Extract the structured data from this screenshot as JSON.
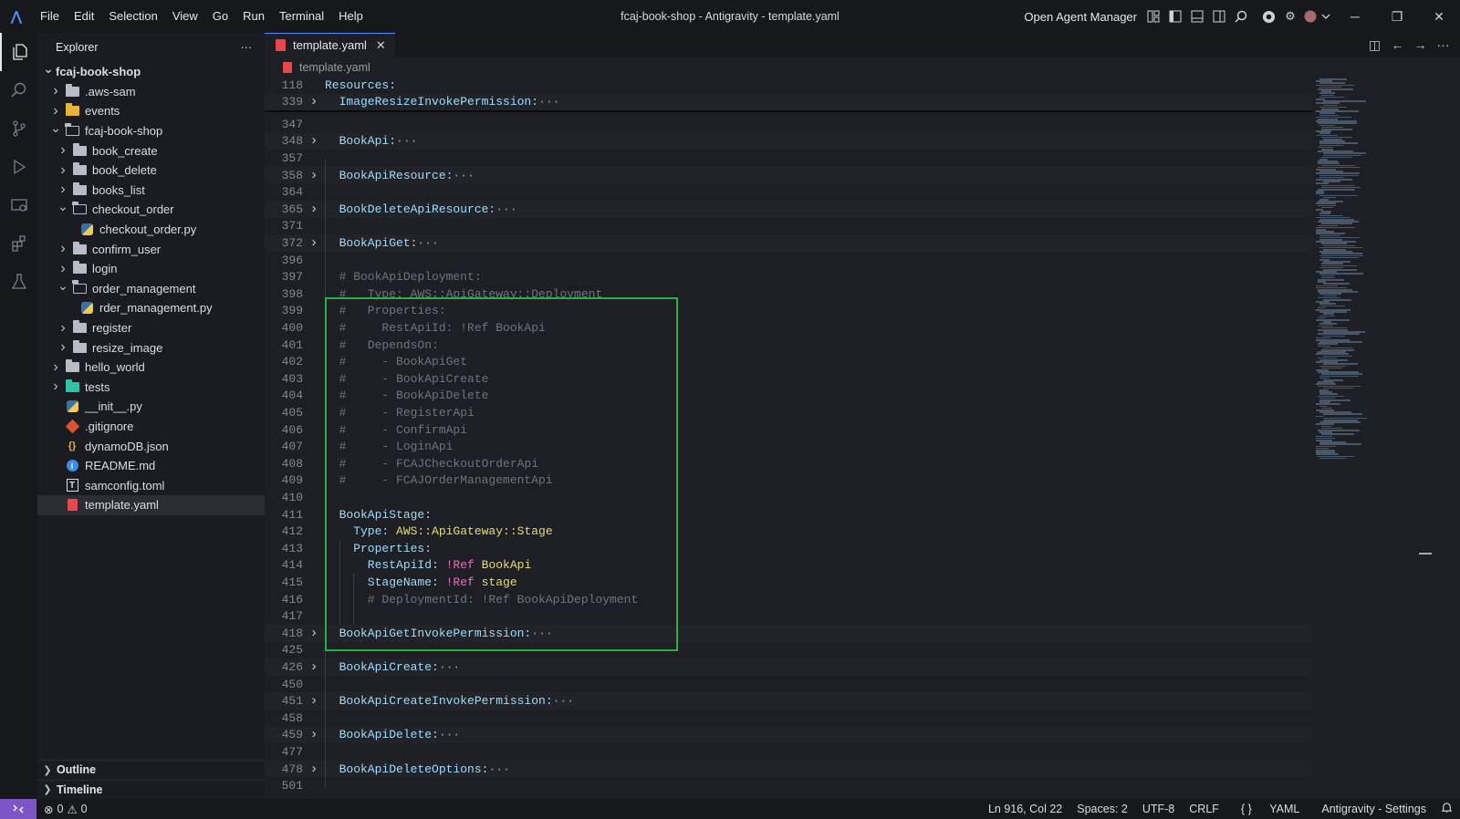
{
  "titlebar": {
    "menu": [
      "File",
      "Edit",
      "Selection",
      "View",
      "Go",
      "Run",
      "Terminal",
      "Help"
    ],
    "window_title": "fcaj-book-shop - Antigravity - template.yaml",
    "agent_manager": "Open Agent Manager"
  },
  "sidebar": {
    "title": "Explorer",
    "more": "···",
    "tree": [
      {
        "label": "fcaj-book-shop",
        "depth": 0,
        "kind": "root",
        "expanded": true
      },
      {
        "label": ".aws-sam",
        "depth": 1,
        "kind": "folder"
      },
      {
        "label": "events",
        "depth": 1,
        "kind": "folder-events"
      },
      {
        "label": "fcaj-book-shop",
        "depth": 1,
        "kind": "folder",
        "expanded": true
      },
      {
        "label": "book_create",
        "depth": 2,
        "kind": "folder"
      },
      {
        "label": "book_delete",
        "depth": 2,
        "kind": "folder"
      },
      {
        "label": "books_list",
        "depth": 2,
        "kind": "folder"
      },
      {
        "label": "checkout_order",
        "depth": 2,
        "kind": "folder",
        "expanded": true
      },
      {
        "label": "checkout_order.py",
        "depth": 3,
        "kind": "py"
      },
      {
        "label": "confirm_user",
        "depth": 2,
        "kind": "folder"
      },
      {
        "label": "login",
        "depth": 2,
        "kind": "folder"
      },
      {
        "label": "order_management",
        "depth": 2,
        "kind": "folder",
        "expanded": true
      },
      {
        "label": "rder_management.py",
        "depth": 3,
        "kind": "py"
      },
      {
        "label": "register",
        "depth": 2,
        "kind": "folder"
      },
      {
        "label": "resize_image",
        "depth": 2,
        "kind": "folder"
      },
      {
        "label": "hello_world",
        "depth": 1,
        "kind": "folder"
      },
      {
        "label": "tests",
        "depth": 1,
        "kind": "folder-tests"
      },
      {
        "label": "__init__.py",
        "depth": 1,
        "kind": "py"
      },
      {
        "label": ".gitignore",
        "depth": 1,
        "kind": "git"
      },
      {
        "label": "dynamoDB.json",
        "depth": 1,
        "kind": "json"
      },
      {
        "label": "README.md",
        "depth": 1,
        "kind": "info"
      },
      {
        "label": "samconfig.toml",
        "depth": 1,
        "kind": "toml"
      },
      {
        "label": "template.yaml",
        "depth": 1,
        "kind": "yaml",
        "selected": true
      }
    ],
    "outline": "Outline",
    "timeline": "Timeline"
  },
  "editor": {
    "tab_label": "template.yaml",
    "breadcrumb": "template.yaml",
    "sticky": [
      {
        "n": "118",
        "text": "Resources:"
      },
      {
        "n": "339",
        "text": "  ImageResizeInvokePermission:",
        "dots": true,
        "fold": true
      }
    ],
    "lines": [
      {
        "n": "347",
        "text": ""
      },
      {
        "n": "348",
        "text": "  BookApi:",
        "dots": true,
        "fold": true
      },
      {
        "n": "357",
        "text": ""
      },
      {
        "n": "358",
        "text": "  BookApiResource:",
        "dots": true,
        "fold": true
      },
      {
        "n": "364",
        "text": ""
      },
      {
        "n": "365",
        "text": "  BookDeleteApiResource:",
        "dots": true,
        "fold": true
      },
      {
        "n": "371",
        "text": ""
      },
      {
        "n": "372",
        "text": "  BookApiGet:",
        "dots": true,
        "fold": true
      },
      {
        "n": "396",
        "text": ""
      },
      {
        "n": "397",
        "text": "  # BookApiDeployment:",
        "comment": true
      },
      {
        "n": "398",
        "text": "  #   Type: AWS::ApiGateway::Deployment",
        "comment": true
      },
      {
        "n": "399",
        "text": "  #   Properties:",
        "comment": true
      },
      {
        "n": "400",
        "text": "  #     RestApiId: !Ref BookApi",
        "comment": true
      },
      {
        "n": "401",
        "text": "  #   DependsOn:",
        "comment": true
      },
      {
        "n": "402",
        "text": "  #     - BookApiGet",
        "comment": true
      },
      {
        "n": "403",
        "text": "  #     - BookApiCreate",
        "comment": true
      },
      {
        "n": "404",
        "text": "  #     - BookApiDelete",
        "comment": true
      },
      {
        "n": "405",
        "text": "  #     - RegisterApi",
        "comment": true
      },
      {
        "n": "406",
        "text": "  #     - ConfirmApi",
        "comment": true
      },
      {
        "n": "407",
        "text": "  #     - LoginApi",
        "comment": true
      },
      {
        "n": "408",
        "text": "  #     - FCAJCheckoutOrderApi",
        "comment": true
      },
      {
        "n": "409",
        "text": "  #     - FCAJOrderManagementApi",
        "comment": true
      },
      {
        "n": "410",
        "text": ""
      },
      {
        "n": "411",
        "text": "  BookApiStage:"
      },
      {
        "n": "412",
        "text": "    Type: AWS::ApiGateway::Stage",
        "kv": [
          "    Type:",
          " AWS::ApiGateway::Stage"
        ]
      },
      {
        "n": "413",
        "text": "    Properties:"
      },
      {
        "n": "414",
        "text": "      RestApiId: !Ref BookApi",
        "ref": [
          "      RestApiId:",
          " !Ref",
          " BookApi"
        ]
      },
      {
        "n": "415",
        "text": "      StageName: !Ref stage",
        "ref": [
          "      StageName:",
          " !Ref",
          " stage"
        ]
      },
      {
        "n": "416",
        "text": "      # DeploymentId: !Ref BookApiDeployment",
        "comment": true
      },
      {
        "n": "417",
        "text": ""
      },
      {
        "n": "418",
        "text": "  BookApiGetInvokePermission:",
        "dots": true,
        "fold": true
      },
      {
        "n": "425",
        "text": ""
      },
      {
        "n": "426",
        "text": "  BookApiCreate:",
        "dots": true,
        "fold": true
      },
      {
        "n": "450",
        "text": ""
      },
      {
        "n": "451",
        "text": "  BookApiCreateInvokePermission:",
        "dots": true,
        "fold": true
      },
      {
        "n": "458",
        "text": ""
      },
      {
        "n": "459",
        "text": "  BookApiDelete:",
        "dots": true,
        "fold": true
      },
      {
        "n": "477",
        "text": ""
      },
      {
        "n": "478",
        "text": "  BookApiDeleteOptions:",
        "dots": true,
        "fold": true
      },
      {
        "n": "501",
        "text": ""
      }
    ]
  },
  "statusbar": {
    "errors": "0",
    "warnings": "0",
    "position": "Ln 916, Col 22",
    "spaces": "Spaces: 2",
    "encoding": "UTF-8",
    "eol": "CRLF",
    "language": "YAML",
    "language_icon": "{ }",
    "settings": "Antigravity - Settings"
  },
  "colors": {
    "highlight_box": "#25b04a",
    "key": "#9cdcfe",
    "comment": "#6f7380",
    "string": "#e6db74",
    "tag": "#f06ec0",
    "remote": "#7e55c7"
  }
}
